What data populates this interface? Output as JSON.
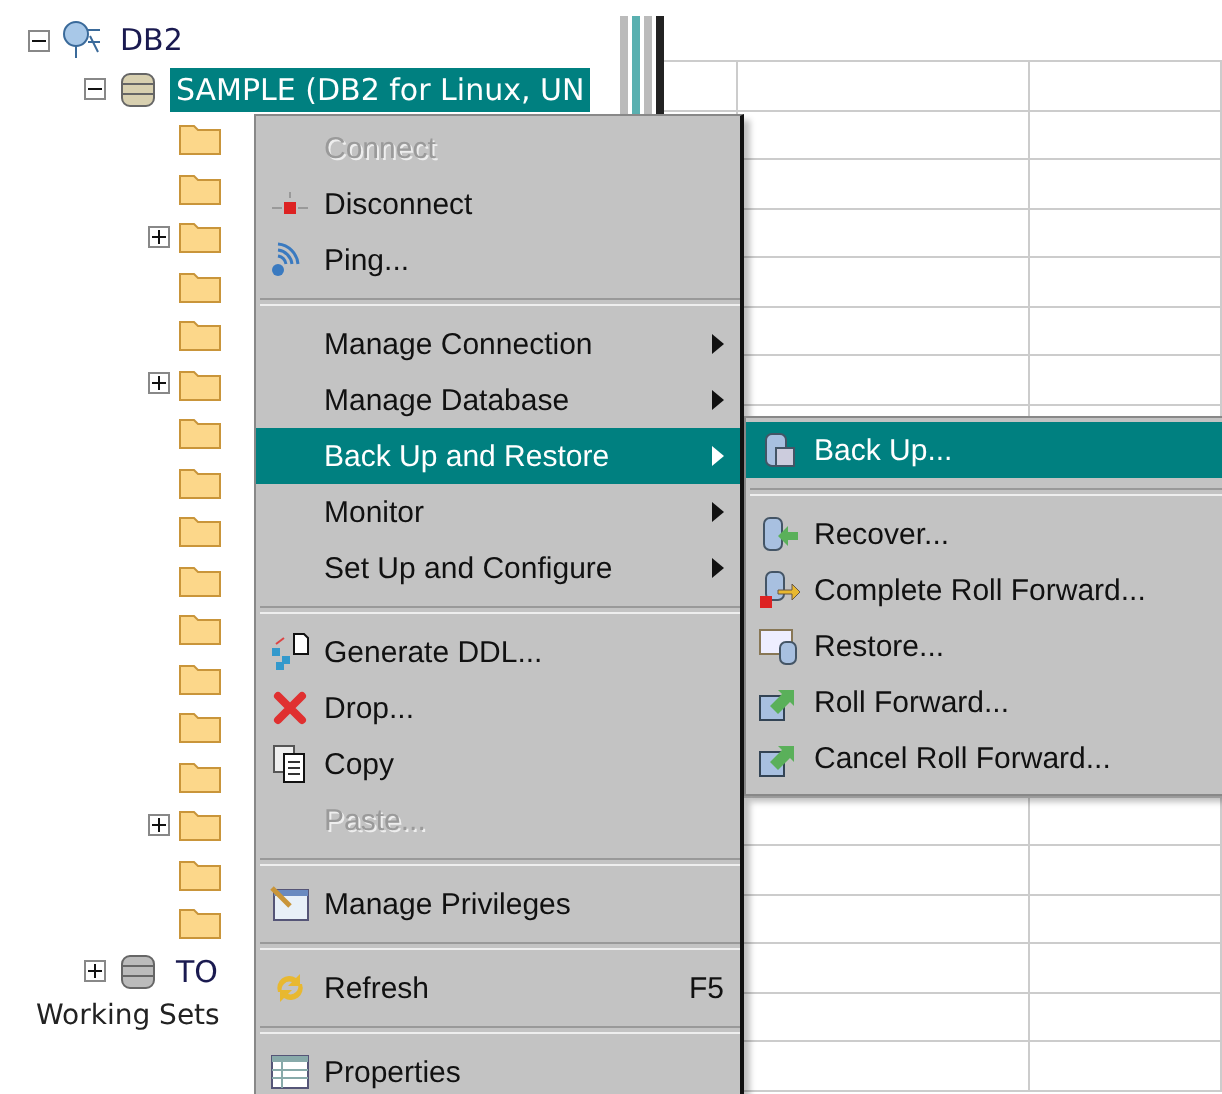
{
  "tree": [
    {
      "label": "DB2",
      "expanded": true,
      "kind": "instance",
      "children": [
        {
          "label": "SAMPLE (DB2 for Linux, UN",
          "expanded": true,
          "selected": true,
          "kind": "database",
          "children": [
            {
              "kind": "folder",
              "expandable": false
            },
            {
              "kind": "folder",
              "expandable": false
            },
            {
              "kind": "folder",
              "expandable": true
            },
            {
              "kind": "folder",
              "expandable": false
            },
            {
              "kind": "folder",
              "expandable": false
            },
            {
              "kind": "folder",
              "expandable": true
            },
            {
              "kind": "folder",
              "expandable": false
            },
            {
              "kind": "folder",
              "expandable": false
            },
            {
              "kind": "folder",
              "expandable": false
            },
            {
              "kind": "folder",
              "expandable": false
            },
            {
              "kind": "folder",
              "expandable": false
            },
            {
              "kind": "folder",
              "expandable": false
            },
            {
              "kind": "folder",
              "expandable": false
            },
            {
              "kind": "folder",
              "expandable": false
            },
            {
              "kind": "folder",
              "expandable": true
            },
            {
              "kind": "folder",
              "expandable": false
            },
            {
              "kind": "folder",
              "expandable": false
            }
          ]
        },
        {
          "label": "TO",
          "expanded": false,
          "selected": false,
          "kind": "database"
        }
      ]
    }
  ],
  "working_sets": {
    "label": "Working Sets"
  },
  "context_menu": [
    {
      "kind": "item",
      "label": "Connect",
      "disabled": true
    },
    {
      "kind": "item",
      "label": "Disconnect",
      "disabled": false
    },
    {
      "kind": "item",
      "label": "Ping...",
      "disabled": false
    },
    {
      "kind": "separator"
    },
    {
      "kind": "submenu",
      "label": "Manage Connection",
      "selected": false
    },
    {
      "kind": "submenu",
      "label": "Manage Database",
      "selected": false
    },
    {
      "kind": "submenu",
      "label": "Back Up and Restore",
      "selected": true
    },
    {
      "kind": "submenu",
      "label": "Monitor",
      "selected": false
    },
    {
      "kind": "submenu",
      "label": "Set Up and Configure",
      "selected": false
    },
    {
      "kind": "separator"
    },
    {
      "kind": "item",
      "label": "Generate DDL...",
      "disabled": false
    },
    {
      "kind": "item",
      "label": "Drop...",
      "disabled": false
    },
    {
      "kind": "item",
      "label": "Copy",
      "disabled": false
    },
    {
      "kind": "item",
      "label": "Paste...",
      "disabled": true
    },
    {
      "kind": "separator"
    },
    {
      "kind": "item",
      "label": "Manage Privileges",
      "disabled": false
    },
    {
      "kind": "separator"
    },
    {
      "kind": "item",
      "label": "Refresh",
      "shortcut": "F5",
      "disabled": false
    },
    {
      "kind": "separator"
    },
    {
      "kind": "item",
      "label": "Properties",
      "disabled": false
    }
  ],
  "submenu": [
    {
      "kind": "item",
      "label": "Back Up...",
      "selected": true
    },
    {
      "kind": "separator"
    },
    {
      "kind": "item",
      "label": "Recover...",
      "selected": false
    },
    {
      "kind": "item",
      "label": "Complete Roll Forward...",
      "selected": false
    },
    {
      "kind": "item",
      "label": "Restore...",
      "selected": false
    },
    {
      "kind": "item",
      "label": "Roll Forward...",
      "selected": false
    },
    {
      "kind": "item",
      "label": "Cancel Roll Forward...",
      "selected": false
    }
  ]
}
